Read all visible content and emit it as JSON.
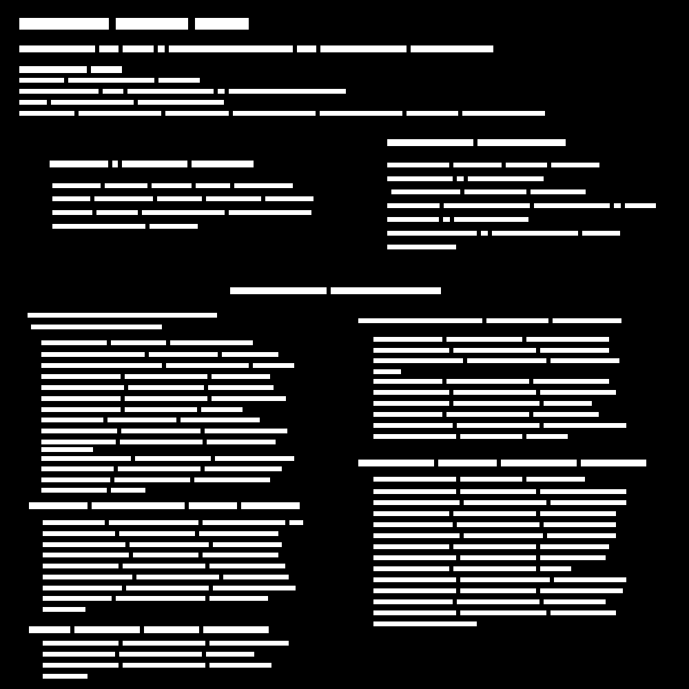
{
  "page": {
    "background": "#000000",
    "foreground": "#ffffff",
    "note_on_text": ""
  }
}
